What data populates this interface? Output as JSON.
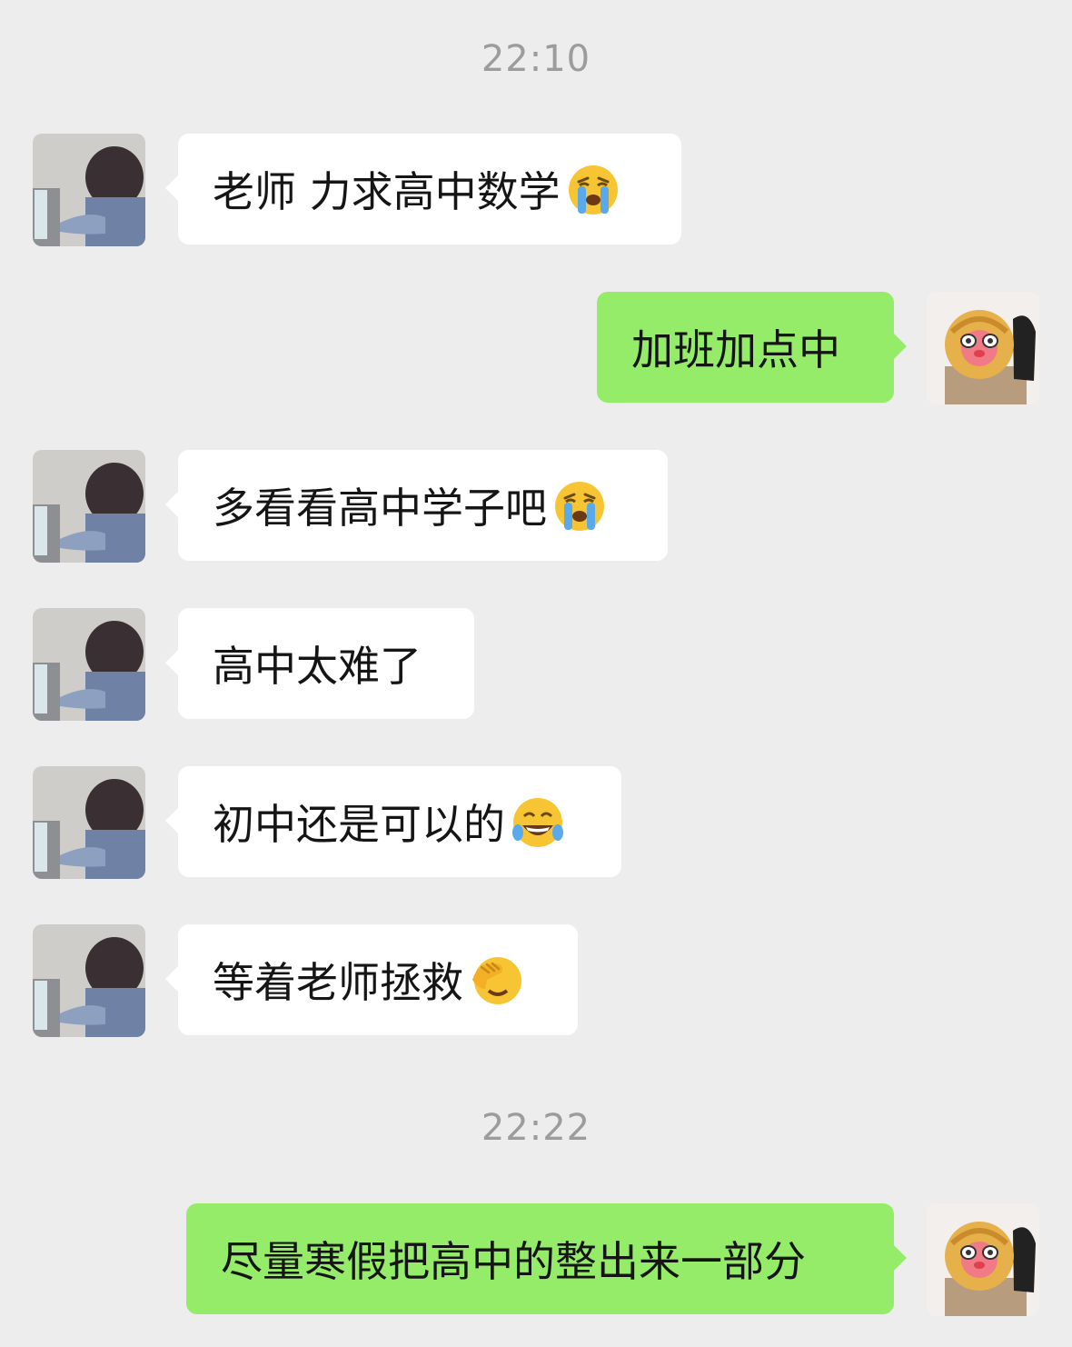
{
  "timestamps": [
    "22:10",
    "22:22"
  ],
  "messages": [
    {
      "side": "left",
      "text": "老师 力求高中数学",
      "emoji": "loudly-crying-emoji"
    },
    {
      "side": "right",
      "text": "加班加点中",
      "emoji": ""
    },
    {
      "side": "left",
      "text": "多看看高中学子吧",
      "emoji": "loudly-crying-emoji"
    },
    {
      "side": "left",
      "text": "高中太难了",
      "emoji": ""
    },
    {
      "side": "left",
      "text": "初中还是可以的",
      "emoji": "tears-of-joy-emoji"
    },
    {
      "side": "left",
      "text": "等着老师拯救",
      "emoji": "facepalm-emoji"
    },
    {
      "side": "right",
      "text": "尽量寒假把高中的整出来一部分",
      "emoji": ""
    }
  ],
  "colors": {
    "background": "#ededed",
    "incoming_bubble": "#ffffff",
    "outgoing_bubble": "#95ec69",
    "timestamp_text": "#9c9c9c"
  }
}
